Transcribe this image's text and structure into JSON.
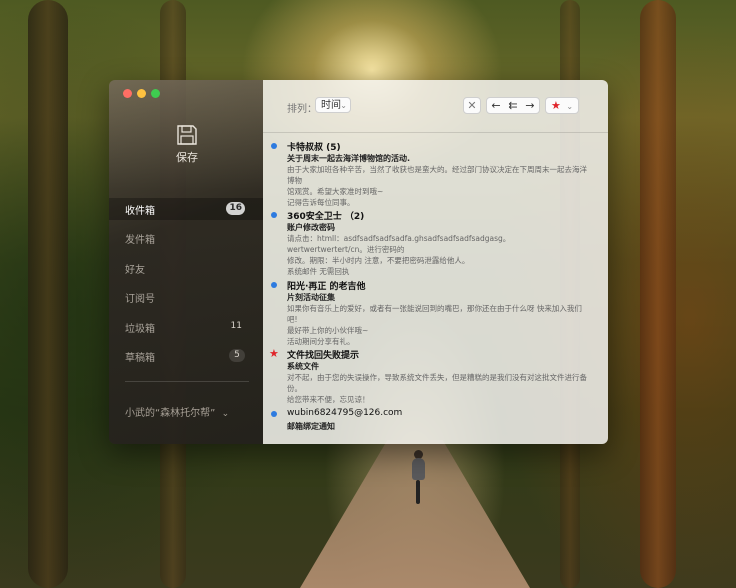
{
  "window": {
    "traffic_lights": {
      "close": "#ff5f57",
      "minimize": "#febc2e",
      "zoom": "#28c840"
    }
  },
  "sidebar": {
    "save_icon": "floppy-disk-icon",
    "save_label": "保存",
    "items": [
      {
        "label": "收件箱",
        "count": "16",
        "active": true
      },
      {
        "label": "发件箱",
        "count": ""
      },
      {
        "label": "好友",
        "count": ""
      },
      {
        "label": "订阅号",
        "count": ""
      },
      {
        "label": "垃圾箱",
        "count": "11"
      },
      {
        "label": "草稿箱",
        "count": "5"
      }
    ],
    "account": "小武的“森林托尔帮”",
    "account_icon": "chevron-down-icon"
  },
  "toolbar": {
    "sort_label": "排列：",
    "sort_value": "时间",
    "delete_icon": "close-icon",
    "reply_icon": "reply-icon",
    "reply_all_icon": "reply-all-icon",
    "forward_icon": "forward-icon",
    "flag_icon": "star-icon",
    "flag_color": "#e0242a"
  },
  "mails": [
    {
      "marker": "unread",
      "from": "卡特叔叔 (5)",
      "subject": "关于周末一起去海洋博物馆的活动.",
      "body": [
        "由于大家加班各种辛苦，当然了收获也是蛮大的。经过部门协议决定在下周周末一起去海洋博物",
        "馆观赏。希望大家准时到哦~",
        "记得告诉每位同事。"
      ]
    },
    {
      "marker": "unread",
      "from": "360安全卫士 （2)",
      "subject": "账户修改密码",
      "body": [
        "请点击：htmll：asdfsadfsadfsadfa.ghsadfsadfsadfsadgasg。wertwertwertert/cn。进行密码的",
        "修改。期限：半小时内 注意，不要把密码泄露给他人。",
        "系统邮件 无需回执"
      ]
    },
    {
      "marker": "unread",
      "from": "阳光·再正 的老吉他",
      "subject": "片刻活动征集",
      "body": [
        "如果你有音乐上的爱好，或者有一张能说回到的嘴巴，那你还在由于什么呀 快来加入我们吧!",
        "最好带上你的小伙伴哦~",
        "活动期间分享有礼。"
      ]
    },
    {
      "marker": "flagged",
      "from": "文件找回失败提示",
      "subject": "系统文件",
      "body": [
        "对不起，由于您的失误操作，导致系统文件丢失，但是糟糕的是我们没有对这批文件进行备份。",
        "给您带来不便，忘见谅！"
      ]
    },
    {
      "marker": "unread",
      "from": "wubin6824795@126.com",
      "subject": "邮箱绑定通知",
      "body": []
    }
  ],
  "colors": {
    "accent": "#2d7be0",
    "flag": "#e0242a"
  }
}
